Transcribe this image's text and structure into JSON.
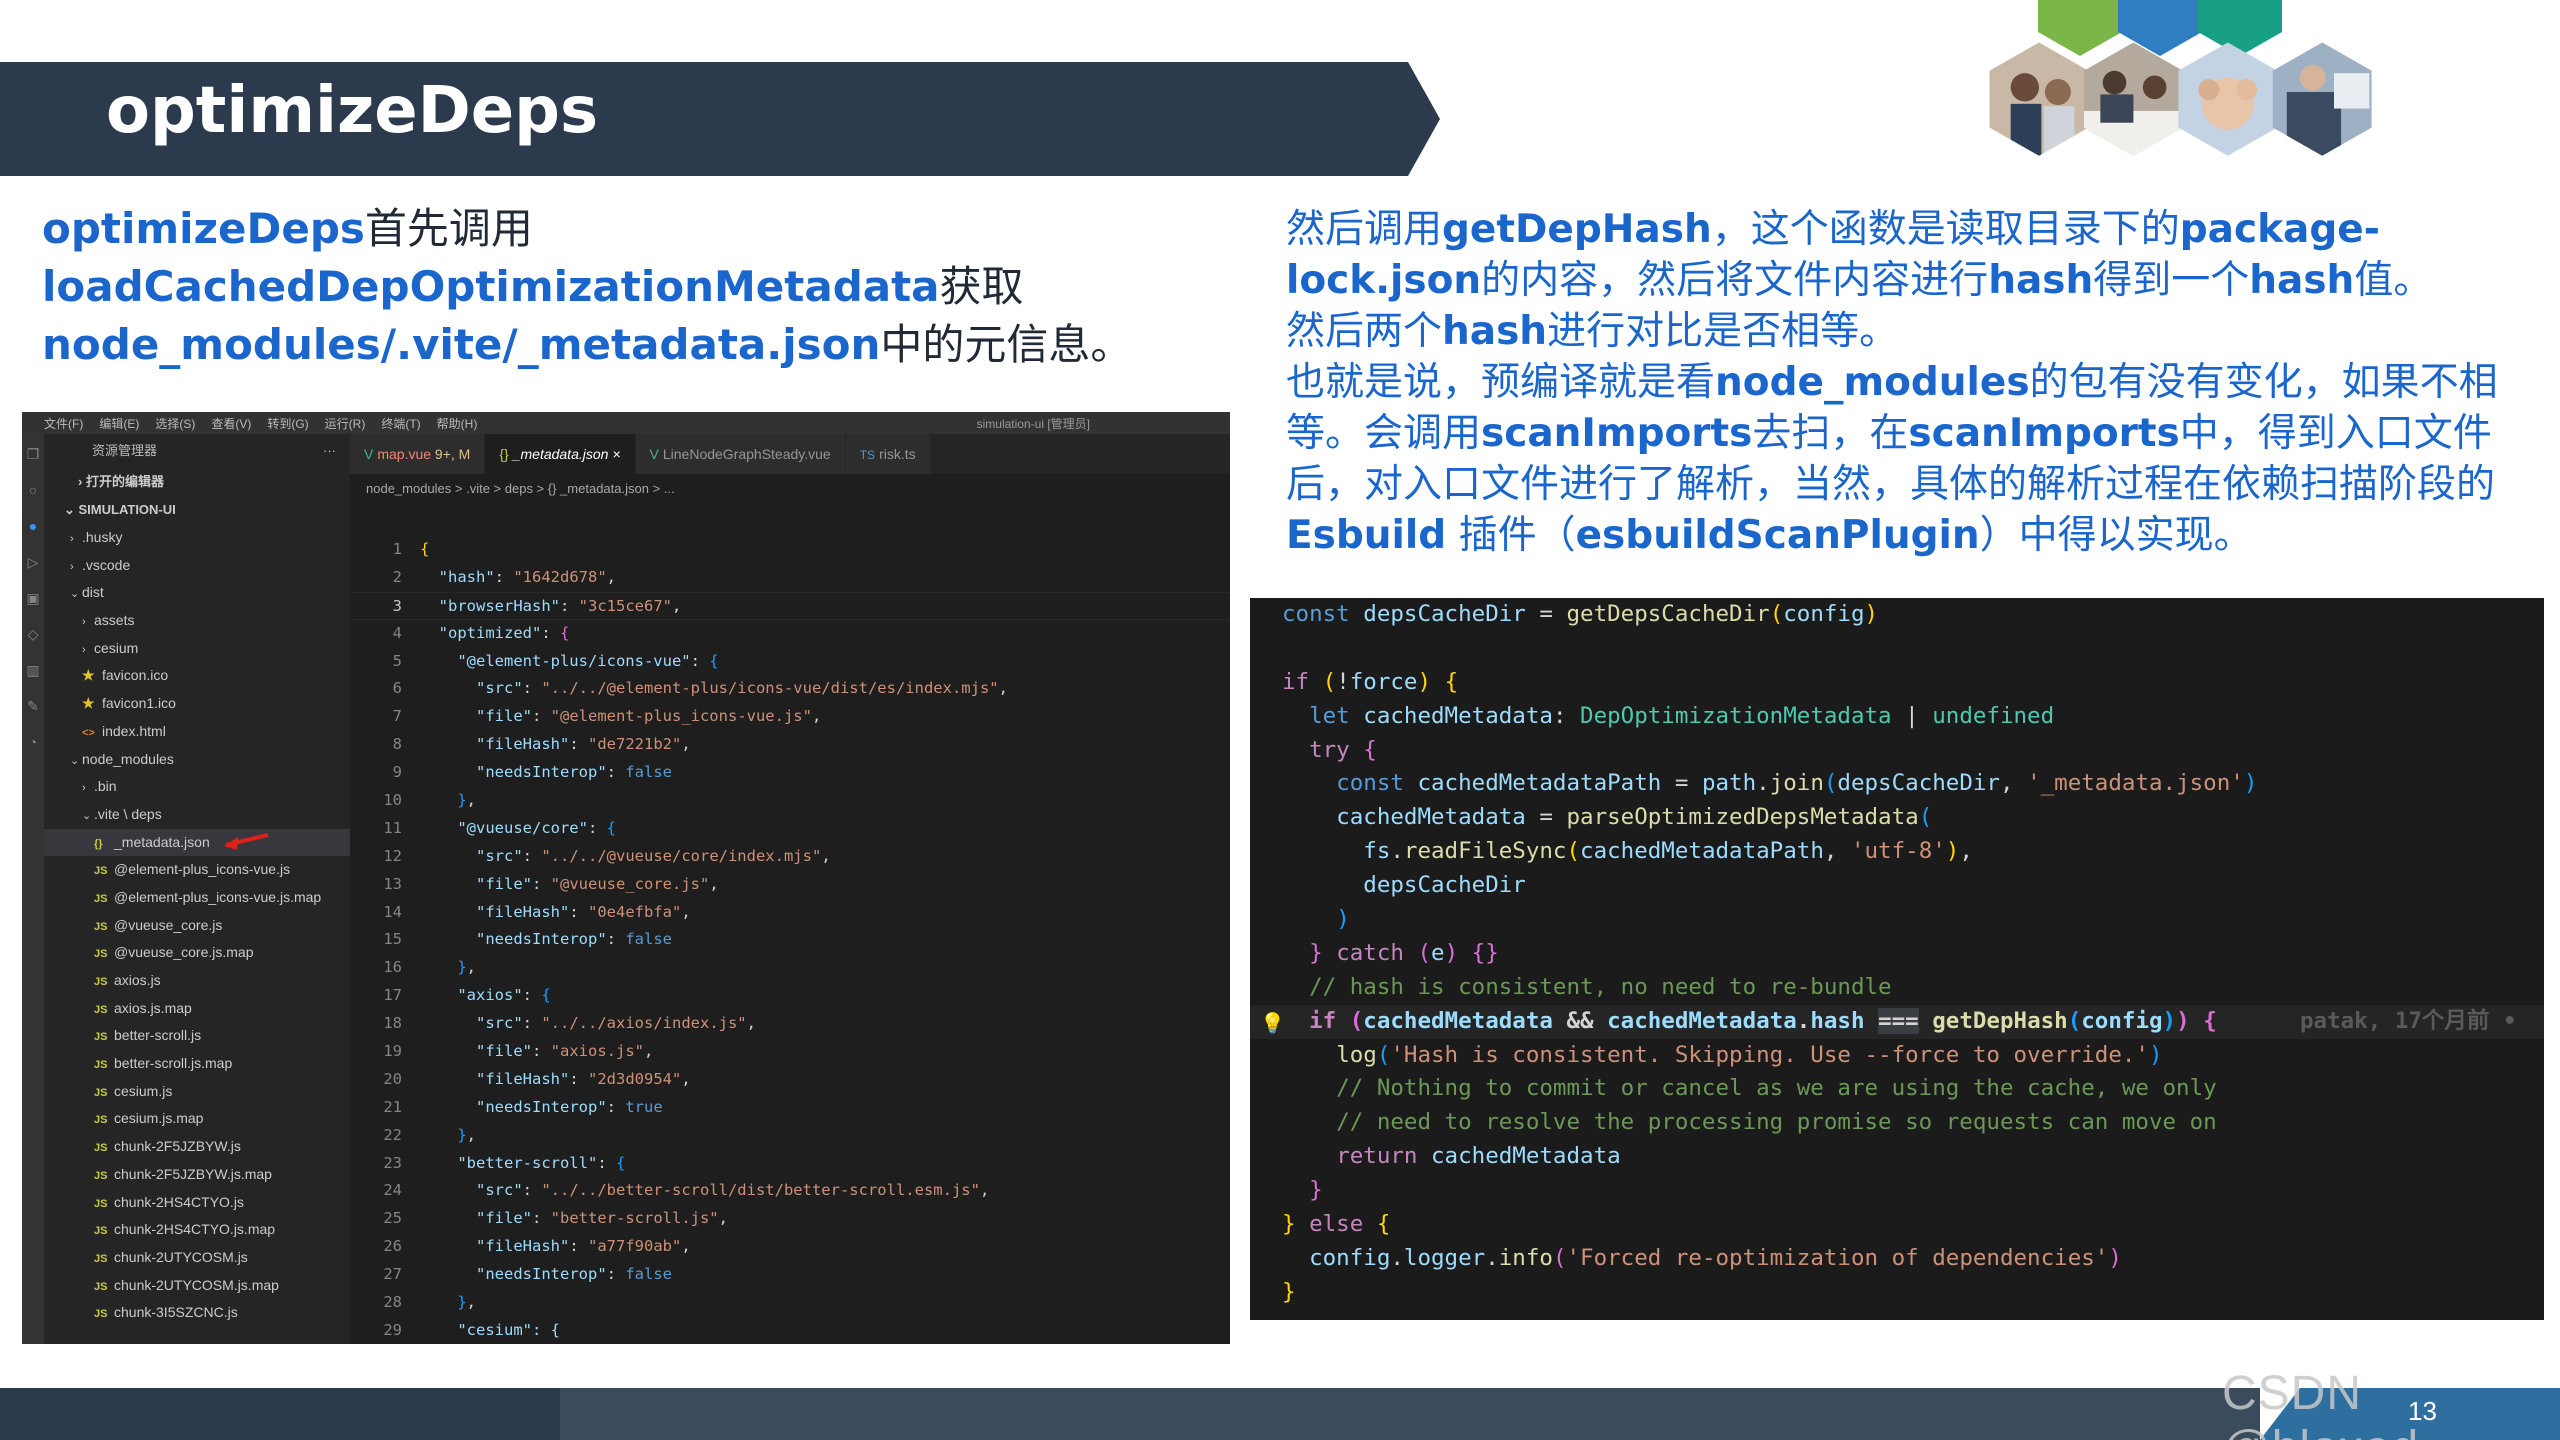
{
  "slide": {
    "title": "optimizeDeps",
    "page_number": "13",
    "watermark": "CSDN @bloxed"
  },
  "left_desc": {
    "l1_hl": "optimizeDeps",
    "l1_text": "首先调用",
    "l2_hl": "loadCachedDepOptimizationMetadata",
    "l2_text": "获取",
    "l3_hl": "node_modules/.vite/_metadata.json",
    "l3_text": "中的元信息。"
  },
  "right_desc": {
    "p1_a": "然后调用",
    "p1_b": "getDepHash",
    "p1_c": "，这个函数是读取目录下的",
    "p1_d": "package-lock.json",
    "p1_e": "的内容，然后将文件内容进行",
    "p1_f": "hash",
    "p1_g": "得到一个",
    "p1_h": "hash",
    "p1_i": "值。",
    "p2_a": "然后两个",
    "p2_b": "hash",
    "p2_c": "进行对比是否相等。",
    "p3_a": "也就是说，预编译就是看",
    "p3_b": "node_modules",
    "p3_c": "的包有没有变化，如果不相等。会调用",
    "p3_d": "scanImports",
    "p3_e": "去扫，在",
    "p3_f": "scanImports",
    "p3_g": "中，得到入口文件后，对入口文件进行了解析，当然，具体的解析过程在依赖扫描阶段的 ",
    "p3_h": "Esbuild",
    "p3_i": " 插件（",
    "p3_j": "esbuildScanPlugin",
    "p3_k": "）中得以实现。"
  },
  "vscode": {
    "menu": [
      "文件(F)",
      "编辑(E)",
      "选择(S)",
      "查看(V)",
      "转到(G)",
      "运行(R)",
      "终端(T)",
      "帮助(H)"
    ],
    "window_title": "simulation-ui [管理员]",
    "explorer_title": "资源管理器",
    "explorer_more": "···",
    "open_editors": "打开的编辑器",
    "project": "SIMULATION-UI",
    "tree": [
      {
        "label": ".husky",
        "type": "folder",
        "indent": 1,
        "open": false
      },
      {
        "label": ".vscode",
        "type": "folder",
        "indent": 1,
        "open": false
      },
      {
        "label": "dist",
        "type": "folder",
        "indent": 1,
        "open": true
      },
      {
        "label": "assets",
        "type": "folder",
        "indent": 2,
        "open": false
      },
      {
        "label": "cesium",
        "type": "folder",
        "indent": 2,
        "open": false
      },
      {
        "label": "favicon.ico",
        "type": "star",
        "indent": 2
      },
      {
        "label": "favicon1.ico",
        "type": "star",
        "indent": 2
      },
      {
        "label": "index.html",
        "type": "html",
        "indent": 2
      },
      {
        "label": "node_modules",
        "type": "folder",
        "indent": 1,
        "open": true
      },
      {
        "label": ".bin",
        "type": "folder",
        "indent": 2,
        "open": false
      },
      {
        "label": ".vite \\ deps",
        "type": "folder",
        "indent": 2,
        "open": true
      },
      {
        "label": "_metadata.json",
        "type": "json",
        "indent": 3,
        "selected": true
      },
      {
        "label": "@element-plus_icons-vue.js",
        "type": "js",
        "indent": 3
      },
      {
        "label": "@element-plus_icons-vue.js.map",
        "type": "js",
        "indent": 3
      },
      {
        "label": "@vueuse_core.js",
        "type": "js",
        "indent": 3
      },
      {
        "label": "@vueuse_core.js.map",
        "type": "js",
        "indent": 3
      },
      {
        "label": "axios.js",
        "type": "js",
        "indent": 3
      },
      {
        "label": "axios.js.map",
        "type": "js",
        "indent": 3
      },
      {
        "label": "better-scroll.js",
        "type": "js",
        "indent": 3
      },
      {
        "label": "better-scroll.js.map",
        "type": "js",
        "indent": 3
      },
      {
        "label": "cesium.js",
        "type": "js",
        "indent": 3
      },
      {
        "label": "cesium.js.map",
        "type": "js",
        "indent": 3
      },
      {
        "label": "chunk-2F5JZBYW.js",
        "type": "js",
        "indent": 3
      },
      {
        "label": "chunk-2F5JZBYW.js.map",
        "type": "js",
        "indent": 3
      },
      {
        "label": "chunk-2HS4CTYO.js",
        "type": "js",
        "indent": 3
      },
      {
        "label": "chunk-2HS4CTYO.js.map",
        "type": "js",
        "indent": 3
      },
      {
        "label": "chunk-2UTYCOSM.js",
        "type": "js",
        "indent": 3
      },
      {
        "label": "chunk-2UTYCOSM.js.map",
        "type": "js",
        "indent": 3
      },
      {
        "label": "chunk-3I5SZCNC.js",
        "type": "js",
        "indent": 3
      }
    ],
    "tabs": [
      {
        "label": "map.vue",
        "suffix": "9+, M",
        "icon": "vue",
        "active": false
      },
      {
        "label": "_metadata.json",
        "suffix": "×",
        "icon": "json",
        "active": true
      },
      {
        "label": "LineNodeGraphSteady.vue",
        "suffix": "",
        "icon": "vue",
        "active": false
      },
      {
        "label": "risk.ts",
        "suffix": "",
        "icon": "ts",
        "active": false
      }
    ],
    "breadcrumb": "node_modules > .vite > deps > {} _metadata.json > ...",
    "code_lines": [
      {
        "n": "1",
        "t": "{",
        "kind": "brace"
      },
      {
        "n": "2",
        "key": "\"hash\"",
        "val": "\"1642d678\"",
        "indent": 1,
        "kind": "kv"
      },
      {
        "n": "3",
        "key": "\"browserHash\"",
        "val": "\"3c15ce67\"",
        "indent": 1,
        "kind": "kv",
        "cur": true
      },
      {
        "n": "4",
        "key": "\"optimized\"",
        "open": "{",
        "indent": 1,
        "kind": "obj"
      },
      {
        "n": "5",
        "key": "\"@element-plus/icons-vue\"",
        "open": "{",
        "indent": 2,
        "kind": "obj"
      },
      {
        "n": "6",
        "key": "\"src\"",
        "val": "\"../../@element-plus/icons-vue/dist/es/index.mjs\"",
        "indent": 3,
        "kind": "kv"
      },
      {
        "n": "7",
        "key": "\"file\"",
        "val": "\"@element-plus_icons-vue.js\"",
        "indent": 3,
        "kind": "kv"
      },
      {
        "n": "8",
        "key": "\"fileHash\"",
        "val": "\"de7221b2\"",
        "indent": 3,
        "kind": "kv"
      },
      {
        "n": "9",
        "key": "\"needsInterop\"",
        "bool": "false",
        "indent": 3,
        "kind": "kvb"
      },
      {
        "n": "10",
        "t": "},",
        "indent": 2,
        "kind": "close"
      },
      {
        "n": "11",
        "key": "\"@vueuse/core\"",
        "open": "{",
        "indent": 2,
        "kind": "obj"
      },
      {
        "n": "12",
        "key": "\"src\"",
        "val": "\"../../@vueuse/core/index.mjs\"",
        "indent": 3,
        "kind": "kv"
      },
      {
        "n": "13",
        "key": "\"file\"",
        "val": "\"@vueuse_core.js\"",
        "indent": 3,
        "kind": "kv"
      },
      {
        "n": "14",
        "key": "\"fileHash\"",
        "val": "\"0e4efbfa\"",
        "indent": 3,
        "kind": "kv"
      },
      {
        "n": "15",
        "key": "\"needsInterop\"",
        "bool": "false",
        "indent": 3,
        "kind": "kvb"
      },
      {
        "n": "16",
        "t": "},",
        "indent": 2,
        "kind": "close"
      },
      {
        "n": "17",
        "key": "\"axios\"",
        "open": "{",
        "indent": 2,
        "kind": "obj"
      },
      {
        "n": "18",
        "key": "\"src\"",
        "val": "\"../../axios/index.js\"",
        "indent": 3,
        "kind": "kv"
      },
      {
        "n": "19",
        "key": "\"file\"",
        "val": "\"axios.js\"",
        "indent": 3,
        "kind": "kv"
      },
      {
        "n": "20",
        "key": "\"fileHash\"",
        "val": "\"2d3d0954\"",
        "indent": 3,
        "kind": "kv"
      },
      {
        "n": "21",
        "key": "\"needsInterop\"",
        "bool": "true",
        "indent": 3,
        "kind": "kvb"
      },
      {
        "n": "22",
        "t": "},",
        "indent": 2,
        "kind": "close"
      },
      {
        "n": "23",
        "key": "\"better-scroll\"",
        "open": "{",
        "indent": 2,
        "kind": "obj"
      },
      {
        "n": "24",
        "key": "\"src\"",
        "val": "\"../../better-scroll/dist/better-scroll.esm.js\"",
        "indent": 3,
        "kind": "kv"
      },
      {
        "n": "25",
        "key": "\"file\"",
        "val": "\"better-scroll.js\"",
        "indent": 3,
        "kind": "kv"
      },
      {
        "n": "26",
        "key": "\"fileHash\"",
        "val": "\"a77f90ab\"",
        "indent": 3,
        "kind": "kv"
      },
      {
        "n": "27",
        "key": "\"needsInterop\"",
        "bool": "false",
        "indent": 3,
        "kind": "kvb"
      },
      {
        "n": "28",
        "t": "},",
        "indent": 2,
        "kind": "close"
      },
      {
        "n": "29",
        "t": "\"cesium\": {",
        "indent": 2,
        "kind": "partial"
      }
    ]
  },
  "snippet": {
    "blame": "patak, 17个月前 •",
    "lines": [
      [
        [
          "c-kw",
          "const "
        ],
        [
          "c-var",
          "depsCacheDir"
        ],
        [
          "c-op",
          " = "
        ],
        [
          "c-fn",
          "getDepsCacheDir"
        ],
        [
          "c-b1",
          "("
        ],
        [
          "c-var",
          "config"
        ],
        [
          "c-b1",
          ")"
        ]
      ],
      [],
      [
        [
          "c-ctl",
          "if "
        ],
        [
          "c-b1",
          "("
        ],
        [
          "c-op",
          "!"
        ],
        [
          "c-var",
          "force"
        ],
        [
          "c-b1",
          ")"
        ],
        [
          "c-op",
          " "
        ],
        [
          "c-b1",
          "{"
        ]
      ],
      [
        [
          "c-op",
          "  "
        ],
        [
          "c-kw",
          "let "
        ],
        [
          "c-var",
          "cachedMetadata"
        ],
        [
          "c-op",
          ": "
        ],
        [
          "c-type",
          "DepOptimizationMetadata"
        ],
        [
          "c-op",
          " | "
        ],
        [
          "c-type",
          "undefined"
        ]
      ],
      [
        [
          "c-op",
          "  "
        ],
        [
          "c-ctl",
          "try "
        ],
        [
          "c-b2",
          "{"
        ]
      ],
      [
        [
          "c-op",
          "    "
        ],
        [
          "c-kw",
          "const "
        ],
        [
          "c-var",
          "cachedMetadataPath"
        ],
        [
          "c-op",
          " = "
        ],
        [
          "c-var",
          "path"
        ],
        [
          "c-op",
          "."
        ],
        [
          "c-fn",
          "join"
        ],
        [
          "c-b3",
          "("
        ],
        [
          "c-var",
          "depsCacheDir"
        ],
        [
          "c-op",
          ", "
        ],
        [
          "c-str",
          "'_metadata.json'"
        ],
        [
          "c-b3",
          ")"
        ]
      ],
      [
        [
          "c-op",
          "    "
        ],
        [
          "c-var",
          "cachedMetadata"
        ],
        [
          "c-op",
          " = "
        ],
        [
          "c-fn",
          "parseOptimizedDepsMetadata"
        ],
        [
          "c-b3",
          "("
        ]
      ],
      [
        [
          "c-op",
          "      "
        ],
        [
          "c-var",
          "fs"
        ],
        [
          "c-op",
          "."
        ],
        [
          "c-fn",
          "readFileSync"
        ],
        [
          "c-b1",
          "("
        ],
        [
          "c-var",
          "cachedMetadataPath"
        ],
        [
          "c-op",
          ", "
        ],
        [
          "c-str",
          "'utf-8'"
        ],
        [
          "c-b1",
          ")"
        ],
        [
          "c-op",
          ","
        ]
      ],
      [
        [
          "c-op",
          "      "
        ],
        [
          "c-var",
          "depsCacheDir"
        ]
      ],
      [
        [
          "c-op",
          "    "
        ],
        [
          "c-b3",
          ")"
        ]
      ],
      [
        [
          "c-op",
          "  "
        ],
        [
          "c-b2",
          "}"
        ],
        [
          "c-op",
          " "
        ],
        [
          "c-ctl",
          "catch "
        ],
        [
          "c-b2",
          "("
        ],
        [
          "c-var",
          "e"
        ],
        [
          "c-b2",
          ")"
        ],
        [
          "c-op",
          " "
        ],
        [
          "c-b2",
          "{}"
        ]
      ],
      [
        [
          "c-op",
          "  "
        ],
        [
          "c-cmt",
          "// hash is consistent, no need to re-bundle"
        ]
      ],
      [
        [
          "c-op",
          "  "
        ],
        [
          "c-ctl",
          "if "
        ],
        [
          "c-b2",
          "("
        ],
        [
          "c-var",
          "cachedMetadata"
        ],
        [
          "c-op",
          " && "
        ],
        [
          "c-var",
          "cachedMetadata"
        ],
        [
          "c-op",
          "."
        ],
        [
          "c-var",
          "hash"
        ],
        [
          "c-op",
          " "
        ],
        [
          "c-op eq-hl",
          "==="
        ],
        [
          "c-op",
          " "
        ],
        [
          "c-fn",
          "getDepHash"
        ],
        [
          "c-b3",
          "("
        ],
        [
          "c-var",
          "config"
        ],
        [
          "c-b3",
          ")"
        ],
        [
          "c-b2",
          ")"
        ],
        [
          "c-op",
          " "
        ],
        [
          "c-b2",
          "{"
        ]
      ],
      [
        [
          "c-op",
          "    "
        ],
        [
          "c-fn",
          "log"
        ],
        [
          "c-b3",
          "("
        ],
        [
          "c-str",
          "'Hash is consistent. Skipping. Use --force to override.'"
        ],
        [
          "c-b3",
          ")"
        ]
      ],
      [
        [
          "c-op",
          "    "
        ],
        [
          "c-cmt",
          "// Nothing to commit or cancel as we are using the cache, we only"
        ]
      ],
      [
        [
          "c-op",
          "    "
        ],
        [
          "c-cmt",
          "// need to resolve the processing promise so requests can move on"
        ]
      ],
      [
        [
          "c-op",
          "    "
        ],
        [
          "c-ctl",
          "return "
        ],
        [
          "c-var",
          "cachedMetadata"
        ]
      ],
      [
        [
          "c-op",
          "  "
        ],
        [
          "c-b2",
          "}"
        ]
      ],
      [
        [
          "c-b1",
          "}"
        ],
        [
          "c-op",
          " "
        ],
        [
          "c-ctl",
          "else "
        ],
        [
          "c-b1",
          "{"
        ]
      ],
      [
        [
          "c-op",
          "  "
        ],
        [
          "c-var",
          "config"
        ],
        [
          "c-op",
          "."
        ],
        [
          "c-var",
          "logger"
        ],
        [
          "c-op",
          "."
        ],
        [
          "c-fn",
          "info"
        ],
        [
          "c-b2",
          "("
        ],
        [
          "c-str",
          "'Forced re-optimization of dependencies'"
        ],
        [
          "c-b2",
          ")"
        ]
      ],
      [
        [
          "c-b1",
          "}"
        ]
      ]
    ],
    "highlight_line": 12
  }
}
